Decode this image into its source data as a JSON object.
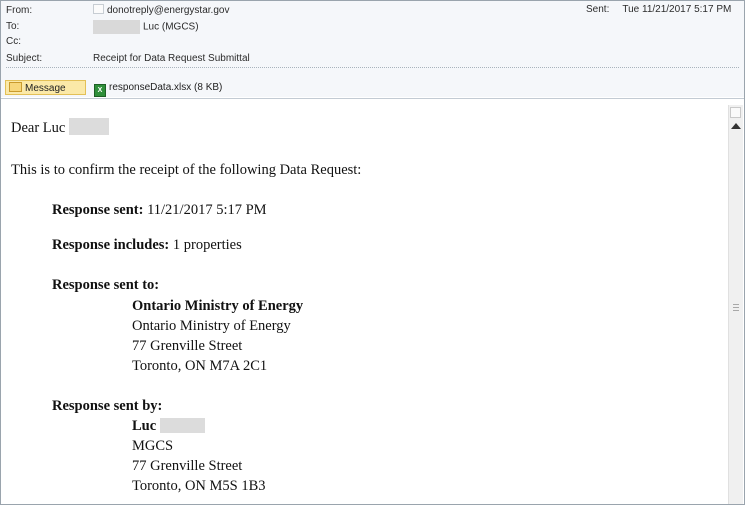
{
  "header": {
    "from_label": "From:",
    "from_value": "donotreply@energystar.gov",
    "to_label": "To:",
    "to_value": "Luc (MGCS)",
    "cc_label": "Cc:",
    "subject_label": "Subject:",
    "subject_value": "Receipt for Data Request Submittal",
    "sent_label": "Sent:",
    "sent_value": "Tue 11/21/2017 5:17 PM"
  },
  "tabs": {
    "message_label": "Message",
    "attachment_label": "responseData.xlsx (8 KB)"
  },
  "body": {
    "greeting": "Dear Luc",
    "intro": "This is to confirm the receipt of the following Data Request:",
    "response_sent_label": "Response sent:",
    "response_sent_value": "11/21/2017 5:17 PM",
    "response_includes_label": "Response includes:",
    "response_includes_value": "1 properties",
    "sent_to": {
      "label": "Response sent to:",
      "org_bold": "Ontario Ministry of Energy",
      "org": "Ontario Ministry of Energy",
      "street": "77 Grenville Street",
      "city": "Toronto, ON M7A 2C1"
    },
    "sent_by": {
      "label": "Response sent by:",
      "name": "Luc",
      "org": "MGCS",
      "street": "77 Grenville Street",
      "city": "Toronto, ON M5S 1B3"
    }
  },
  "icons": {
    "from": "contact-card-icon",
    "message_tab": "envelope-icon",
    "attachment": "excel-file-icon",
    "scroll_top": "view-icon",
    "scroll_up": "arrow-up-icon"
  },
  "colors": {
    "header_bg": "#f5f7fa",
    "message_tab_bg": "#fbe9a8",
    "excel_green": "#2f8f3a",
    "redaction": "#d9d9d9"
  }
}
